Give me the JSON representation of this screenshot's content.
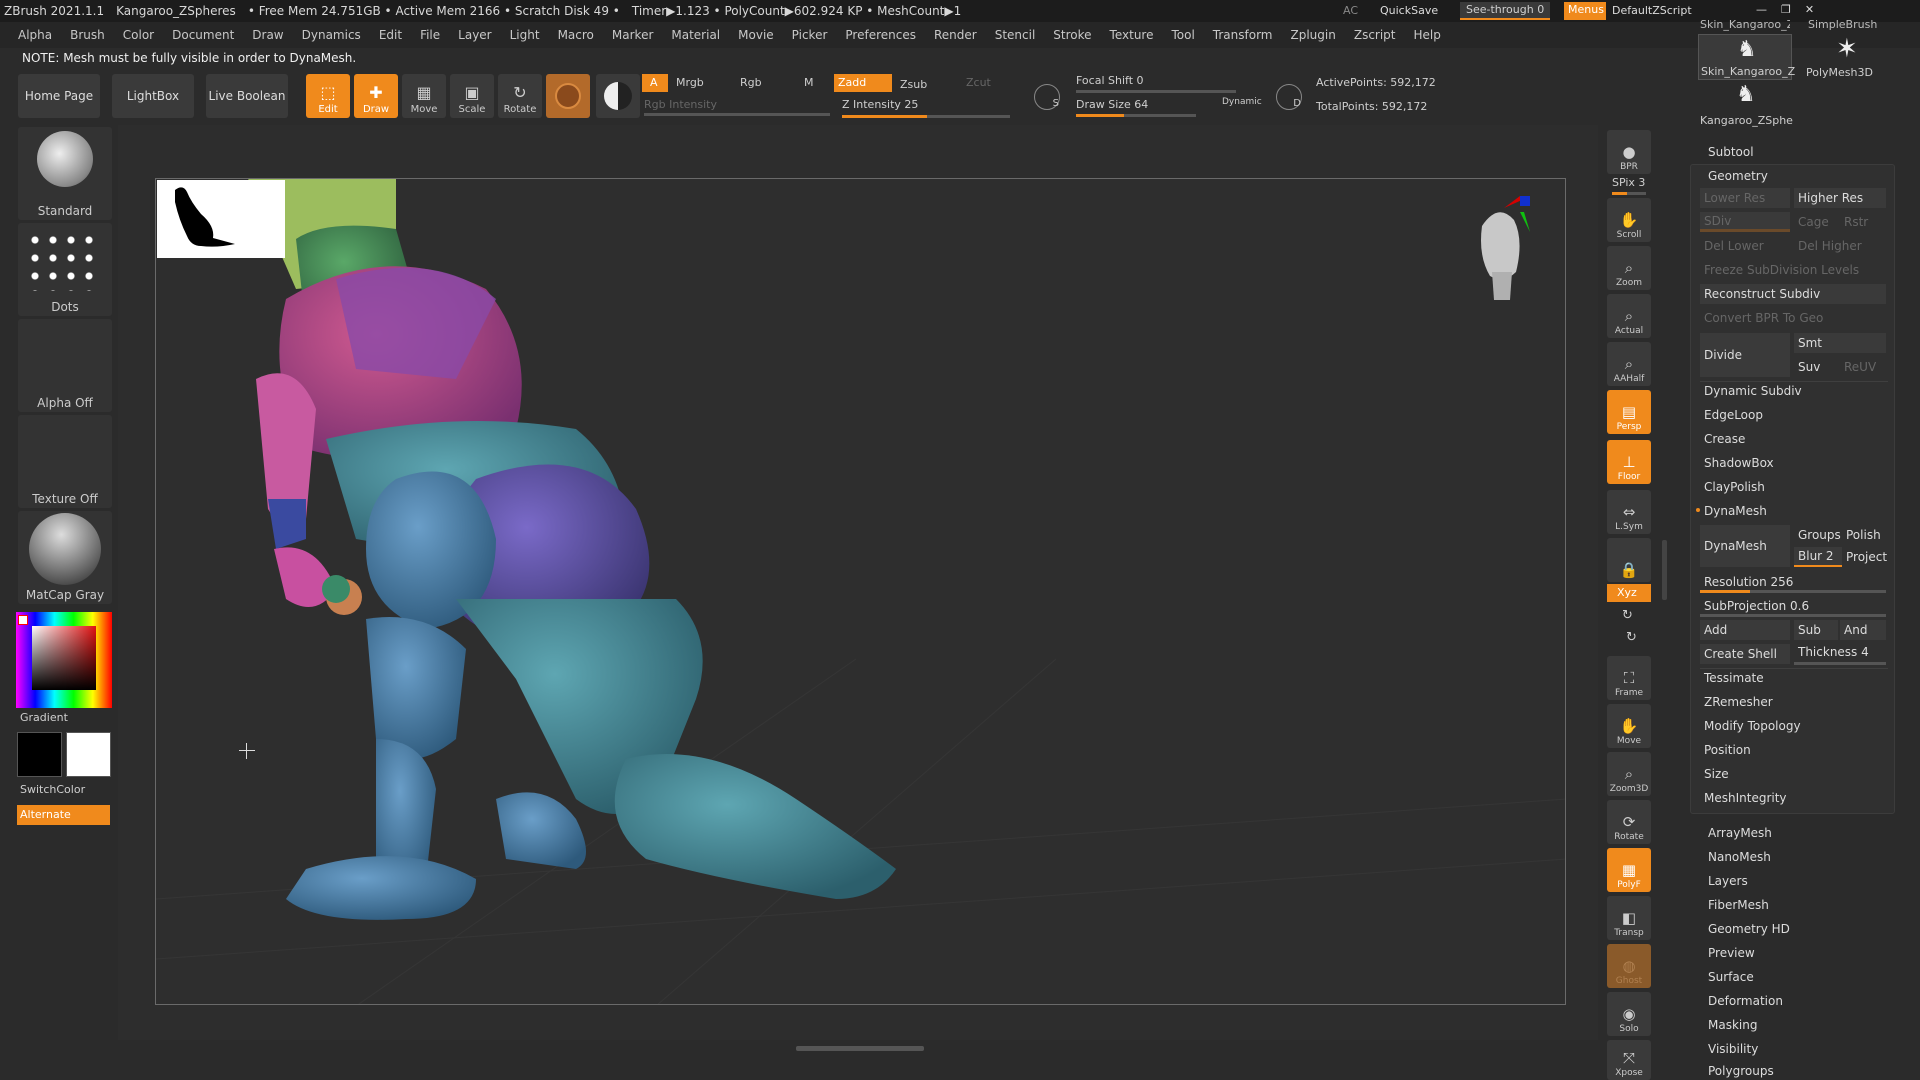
{
  "titlebar": {
    "app": "ZBrush 2021.1.1",
    "doc": "Kangaroo_ZSpheres",
    "stats": "• Free Mem 24.751GB • Active Mem 2166 • Scratch Disk 49 •",
    "timer": "Timer▶1.123 • PolyCount▶602.924 KP • MeshCount▶1",
    "ac": "AC",
    "quicksave": "QuickSave",
    "seethrough": "See-through  0",
    "menus": "Menus",
    "script": "DefaultZScript"
  },
  "menubar": [
    "Alpha",
    "Brush",
    "Color",
    "Document",
    "Draw",
    "Dynamics",
    "Edit",
    "File",
    "Layer",
    "Light",
    "Macro",
    "Marker",
    "Material",
    "Movie",
    "Picker",
    "Preferences",
    "Render",
    "Stencil",
    "Stroke",
    "Texture",
    "Tool",
    "Transform",
    "Zplugin",
    "Zscript",
    "Help"
  ],
  "note": "NOTE: Mesh must be fully visible in order to DynaMesh.",
  "topbar": {
    "home": "Home Page",
    "lightbox": "LightBox",
    "liveboolean": "Live Boolean",
    "edit": "Edit",
    "draw": "Draw",
    "move": "Move",
    "scale": "Scale",
    "rotate": "Rotate",
    "a": "A",
    "mrgb": "Mrgb",
    "rgb": "Rgb",
    "m": "M",
    "zadd": "Zadd",
    "zsub": "Zsub",
    "zcut": "Zcut",
    "rgb_intensity": "Rgb Intensity",
    "z_intensity": "Z Intensity 25",
    "focal_shift": "Focal Shift 0",
    "draw_size": "Draw Size 64",
    "dynamic": "Dynamic",
    "active_points": "ActivePoints: 592,172",
    "total_points": "TotalPoints: 592,172",
    "s": "S",
    "d": "D"
  },
  "left": {
    "brush": "Standard",
    "stroke": "Dots",
    "alpha": "Alpha Off",
    "texture": "Texture Off",
    "material": "MatCap Gray",
    "gradient": "Gradient",
    "switch": "SwitchColor",
    "alternate": "Alternate"
  },
  "right_tools": [
    "BPR",
    "SPix 3",
    "Scroll",
    "Zoom",
    "Actual",
    "AAHalf",
    "Persp",
    "Floor",
    "L.Sym",
    "Lock",
    "Xyz",
    "Frame",
    "Move",
    "Zoom3D",
    "Rotate",
    "PolyF",
    "Transp",
    "Ghost",
    "Solo",
    "Xpose"
  ],
  "thumbs": {
    "t1": "Skin_Kangaroo_Z",
    "t2": "PolyMesh3D",
    "t3": "Kangaroo_ZSphe",
    "top_t1": "Skin_Kangaroo_Z",
    "top_t2": "SimpleBrush"
  },
  "panel": {
    "subtool": "Subtool",
    "geometry": "Geometry",
    "lower_res": "Lower Res",
    "higher_res": "Higher Res",
    "sdiv": "SDiv",
    "cage": "Cage",
    "rstr": "Rstr",
    "del_lower": "Del Lower",
    "del_higher": "Del Higher",
    "freeze": "Freeze SubDivision Levels",
    "reconstruct": "Reconstruct Subdiv",
    "convert_bpr": "Convert BPR To Geo",
    "divide": "Divide",
    "smt": "Smt",
    "suv": "Suv",
    "reuv": "ReUV",
    "dynamic_subdiv": "Dynamic Subdiv",
    "edgeloop": "EdgeLoop",
    "crease": "Crease",
    "shadowbox": "ShadowBox",
    "claypolish": "ClayPolish",
    "dynamesh_header": "DynaMesh",
    "dynamesh_btn": "DynaMesh",
    "groups": "Groups",
    "polish": "Polish",
    "blur": "Blur 2",
    "project": "Project",
    "resolution": "Resolution 256",
    "subprojection": "SubProjection 0.6",
    "add": "Add",
    "sub": "Sub",
    "and": "And",
    "create_shell": "Create Shell",
    "thickness": "Thickness 4",
    "tessimate": "Tessimate",
    "zremesher": "ZRemesher",
    "modify_topology": "Modify Topology",
    "position": "Position",
    "size": "Size",
    "meshintegrity": "MeshIntegrity"
  },
  "subpalettes": [
    "ArrayMesh",
    "NanoMesh",
    "Layers",
    "FiberMesh",
    "Geometry HD",
    "Preview",
    "Surface",
    "Deformation",
    "Masking",
    "Visibility",
    "Polygroups"
  ]
}
